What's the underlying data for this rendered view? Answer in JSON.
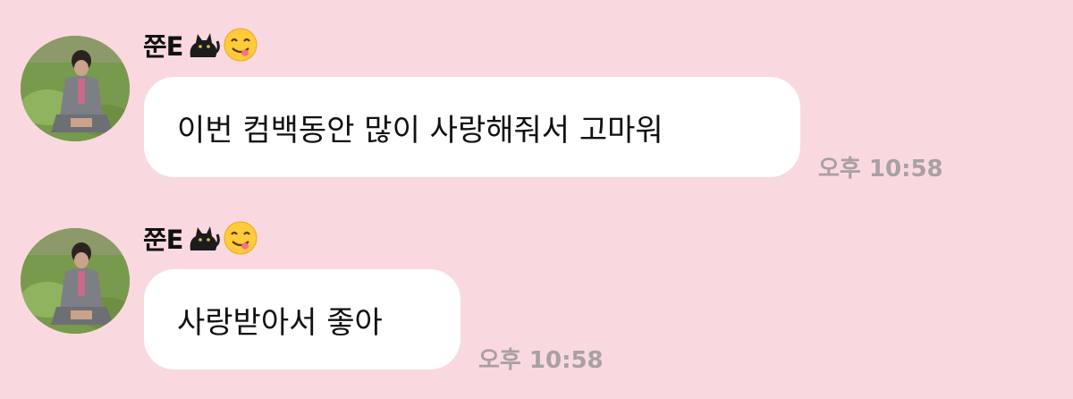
{
  "background_color": "#f9d9df",
  "messages": [
    {
      "sender_name": "쭌E",
      "sender_emojis": [
        "cat-icon",
        "yum-face-icon"
      ],
      "text": "이번 컴백동안 많이 사랑해줘서 고마워",
      "time": "오후 10:58"
    },
    {
      "sender_name": "쭌E",
      "sender_emojis": [
        "cat-icon",
        "yum-face-icon"
      ],
      "text": "사랑받아서 좋아",
      "time": "오후 10:58"
    }
  ]
}
